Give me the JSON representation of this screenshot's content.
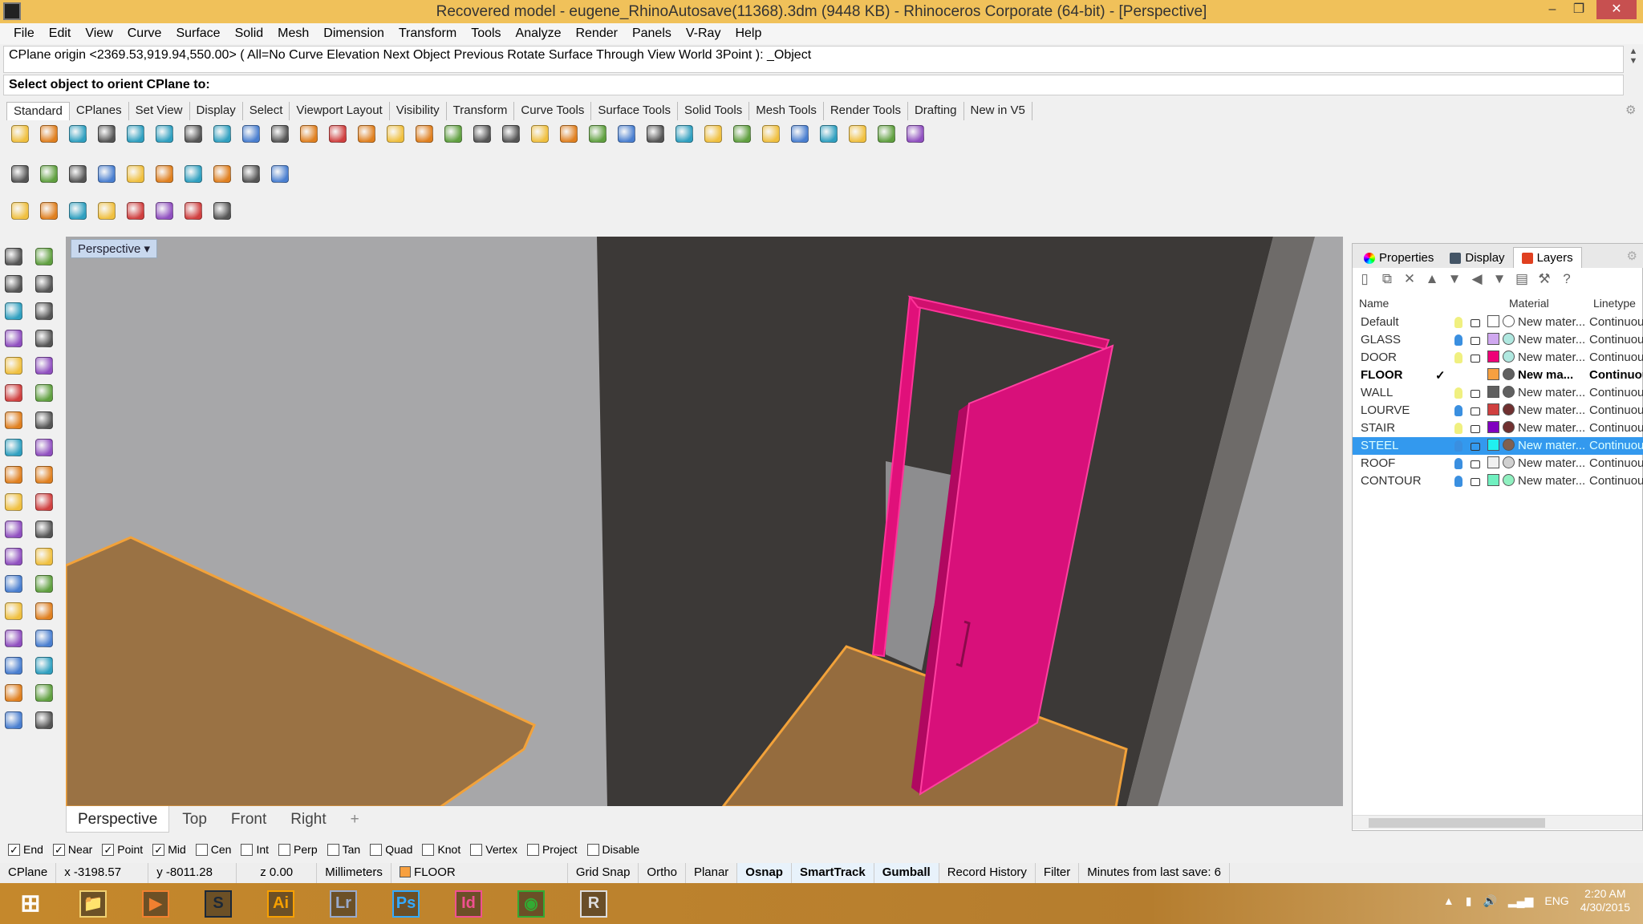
{
  "title": "Recovered model - eugene_RhinoAutosave(11368).3dm (9448 KB) - Rhinoceros Corporate (64-bit) - [Perspective]",
  "menu": [
    "File",
    "Edit",
    "View",
    "Curve",
    "Surface",
    "Solid",
    "Mesh",
    "Dimension",
    "Transform",
    "Tools",
    "Analyze",
    "Render",
    "Panels",
    "V-Ray",
    "Help"
  ],
  "command": {
    "history": "CPlane origin <2369.53,919.94,550.00> ( All=No  Curve  Elevation  Next  Object  Previous  Rotate  Surface  Through  View  World  3Point ): _Object",
    "prompt": "Select object to orient CPlane to:"
  },
  "toolbar_tabs": [
    "Standard",
    "CPlanes",
    "Set View",
    "Display",
    "Select",
    "Viewport Layout",
    "Visibility",
    "Transform",
    "Curve Tools",
    "Surface Tools",
    "Solid Tools",
    "Mesh Tools",
    "Render Tools",
    "Drafting",
    "New in V5"
  ],
  "toolbar_row1": [
    "new-icon",
    "open-icon",
    "save-icon",
    "print-icon",
    "import-icon",
    "cut-icon",
    "copy-icon",
    "paste-icon",
    "undo-icon",
    "pan-icon",
    "move-view-icon",
    "zoom-icon",
    "zoom-window-icon",
    "zoom-extents-icon",
    "zoom-selected-icon",
    "rotate-view-icon",
    "four-viewports-icon",
    "car-icon",
    "point-icon",
    "circle-icon",
    "grid-icon",
    "light-icon",
    "lock-icon",
    "layer-icon",
    "color-wheel-icon",
    "render-sphere-icon",
    "shaded-sphere-icon",
    "blue-sphere-icon",
    "filter-icon",
    "gear-icon",
    "cplane-icon",
    "help-icon"
  ],
  "toolbar_row2": [
    "vray-m-icon",
    "vray-material-icon",
    "vray-tag-icon",
    "vray-render-icon",
    "vray-rt-icon",
    "vray-fly-icon",
    "vray-sun-icon",
    "vray-light-icon",
    "vray-landscape-icon",
    "vray-help-icon"
  ],
  "toolbar_row3": [
    "sun-icon",
    "lamp-icon",
    "sphere-light-icon",
    "dome-light-icon",
    "ies-light-icon",
    "spot-light-icon",
    "arrow-light-icon",
    "directional-light-icon"
  ],
  "left_tools": [
    "select-icon",
    "point-icon",
    "polyline-icon",
    "curve-icon",
    "circle-icon",
    "ellipse-icon",
    "polygon-icon",
    "rectangle-icon",
    "arc-icon",
    "fillet-icon",
    "surface-icon",
    "extrude-icon",
    "box-icon",
    "boolean-icon",
    "cylinder-icon",
    "loft-icon",
    "explode-icon",
    "trim-icon",
    "split-icon",
    "join-icon",
    "group-icon",
    "ungroup-icon",
    "rebuild-icon",
    "offset-icon",
    "text-icon",
    "scale-icon",
    "array-icon",
    "mirror-icon",
    "solid-icon",
    "hatch-icon",
    "grid-array-icon",
    "align-icon",
    "analyze-icon",
    "check-icon",
    "render-icon",
    "paint-icon"
  ],
  "viewport": {
    "label": "Perspective",
    "tabs": [
      "Perspective",
      "Top",
      "Front",
      "Right"
    ],
    "add": "+"
  },
  "panel": {
    "tabs": [
      "Properties",
      "Display",
      "Layers"
    ],
    "columns": {
      "name": "Name",
      "material": "Material",
      "linetype": "Linetype"
    },
    "layers": [
      {
        "name": "Default",
        "bulb": "#f0f080",
        "swatch": "#ffffff",
        "mat": "#ffffff",
        "material": "New mater...",
        "linetype": "Continuous"
      },
      {
        "name": "GLASS",
        "bulb": "#3a8fe0",
        "swatch": "#d0a8f0",
        "mat": "#b0e8e0",
        "material": "New mater...",
        "linetype": "Continuous"
      },
      {
        "name": "DOOR",
        "bulb": "#f0f080",
        "swatch": "#ee0077",
        "mat": "#b0e8e0",
        "material": "New mater...",
        "linetype": "Continuous"
      },
      {
        "name": "FLOOR",
        "current": "✓",
        "swatch": "#f7a040",
        "mat": "#606060",
        "material": "New ma...",
        "linetype": "Continuous",
        "bold": true
      },
      {
        "name": "WALL",
        "bulb": "#f0f080",
        "swatch": "#606060",
        "mat": "#606060",
        "material": "New mater...",
        "linetype": "Continuous"
      },
      {
        "name": "LOURVE",
        "bulb": "#3a8fe0",
        "swatch": "#d04040",
        "mat": "#703030",
        "material": "New mater...",
        "linetype": "Continuous"
      },
      {
        "name": "STAIR",
        "bulb": "#f0f080",
        "swatch": "#8000c0",
        "mat": "#703030",
        "material": "New mater...",
        "linetype": "Continuous"
      },
      {
        "name": "STEEL",
        "bulb": "#3a8fe0",
        "swatch": "#20f0f0",
        "mat": "#806050",
        "material": "New mater...",
        "linetype": "Continuous",
        "selected": true
      },
      {
        "name": "ROOF",
        "bulb": "#3a8fe0",
        "swatch": "#f0f0f0",
        "mat": "#d0d0d0",
        "material": "New mater...",
        "linetype": "Continuous"
      },
      {
        "name": "CONTOUR",
        "bulb": "#3a8fe0",
        "swatch": "#70f0c0",
        "mat": "#90f0c0",
        "material": "New mater...",
        "linetype": "Continuous"
      }
    ]
  },
  "osnap": [
    {
      "label": "End",
      "on": true
    },
    {
      "label": "Near",
      "on": true
    },
    {
      "label": "Point",
      "on": true
    },
    {
      "label": "Mid",
      "on": true
    },
    {
      "label": "Cen",
      "on": false
    },
    {
      "label": "Int",
      "on": false
    },
    {
      "label": "Perp",
      "on": false
    },
    {
      "label": "Tan",
      "on": false
    },
    {
      "label": "Quad",
      "on": false
    },
    {
      "label": "Knot",
      "on": false
    },
    {
      "label": "Vertex",
      "on": false
    },
    {
      "label": "Project",
      "on": false
    },
    {
      "label": "Disable",
      "on": false
    }
  ],
  "status": {
    "cplane": "CPlane",
    "x": "x -3198.57",
    "y": "y -8011.28",
    "z": "z 0.00",
    "units": "Millimeters",
    "layer": "FLOOR",
    "layer_color": "#f7a040",
    "toggles": [
      {
        "label": "Grid Snap",
        "on": false
      },
      {
        "label": "Ortho",
        "on": false
      },
      {
        "label": "Planar",
        "on": false
      },
      {
        "label": "Osnap",
        "on": true
      },
      {
        "label": "SmartTrack",
        "on": true
      },
      {
        "label": "Gumball",
        "on": true
      },
      {
        "label": "Record History",
        "on": false
      },
      {
        "label": "Filter",
        "on": false
      }
    ],
    "save": "Minutes from last save: 6"
  },
  "taskbar": {
    "apps": [
      {
        "name": "file-explorer",
        "label": "📁",
        "color": "#f0d070"
      },
      {
        "name": "media-player",
        "label": "▶",
        "color": "#f08030"
      },
      {
        "name": "steam",
        "label": "S",
        "color": "#1b2838"
      },
      {
        "name": "illustrator",
        "label": "Ai",
        "color": "#f7a000"
      },
      {
        "name": "lightroom",
        "label": "Lr",
        "color": "#9ac"
      },
      {
        "name": "photoshop",
        "label": "Ps",
        "color": "#3af"
      },
      {
        "name": "indesign",
        "label": "Id",
        "color": "#f05090"
      },
      {
        "name": "chrome",
        "label": "◉",
        "color": "#3a3"
      },
      {
        "name": "rhino",
        "label": "R",
        "color": "#ddd"
      }
    ],
    "lang": "ENG",
    "time": "2:20 AM",
    "date": "4/30/2015"
  }
}
